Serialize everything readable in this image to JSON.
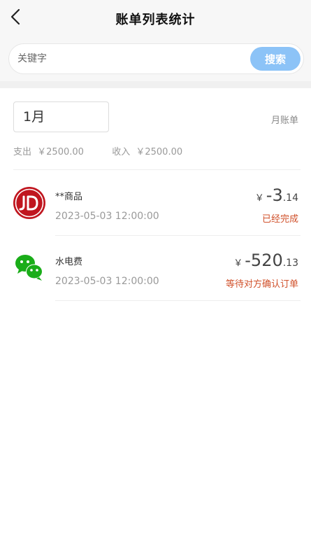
{
  "header": {
    "title": "账单列表统计",
    "back_icon": "chevron-left-icon"
  },
  "search": {
    "placeholder": "关键字",
    "value": "",
    "button_label": "搜索"
  },
  "filter": {
    "month": "1月",
    "monthly_bill_label": "月账单"
  },
  "summary": {
    "expense_label": "支出",
    "expense_value": "￥2500.00",
    "income_label": "收入",
    "income_value": "￥2500.00"
  },
  "transactions": [
    {
      "icon": "jd-logo-icon",
      "name": "**商品",
      "time": "2023-05-03 12:00:00",
      "currency": "￥",
      "amount_int": "-3",
      "amount_dec": ".14",
      "status": "已经完成"
    },
    {
      "icon": "wechat-icon",
      "name": "水电费",
      "time": "2023-05-03 12:00:00",
      "currency": "￥",
      "amount_int": "-520",
      "amount_dec": ".13",
      "status": "等待对方确认订单"
    }
  ],
  "colors": {
    "accent_button": "#8cc3f7",
    "status": "#d0502a",
    "jd_red": "#c0161f",
    "wechat_green": "#1aad19"
  }
}
